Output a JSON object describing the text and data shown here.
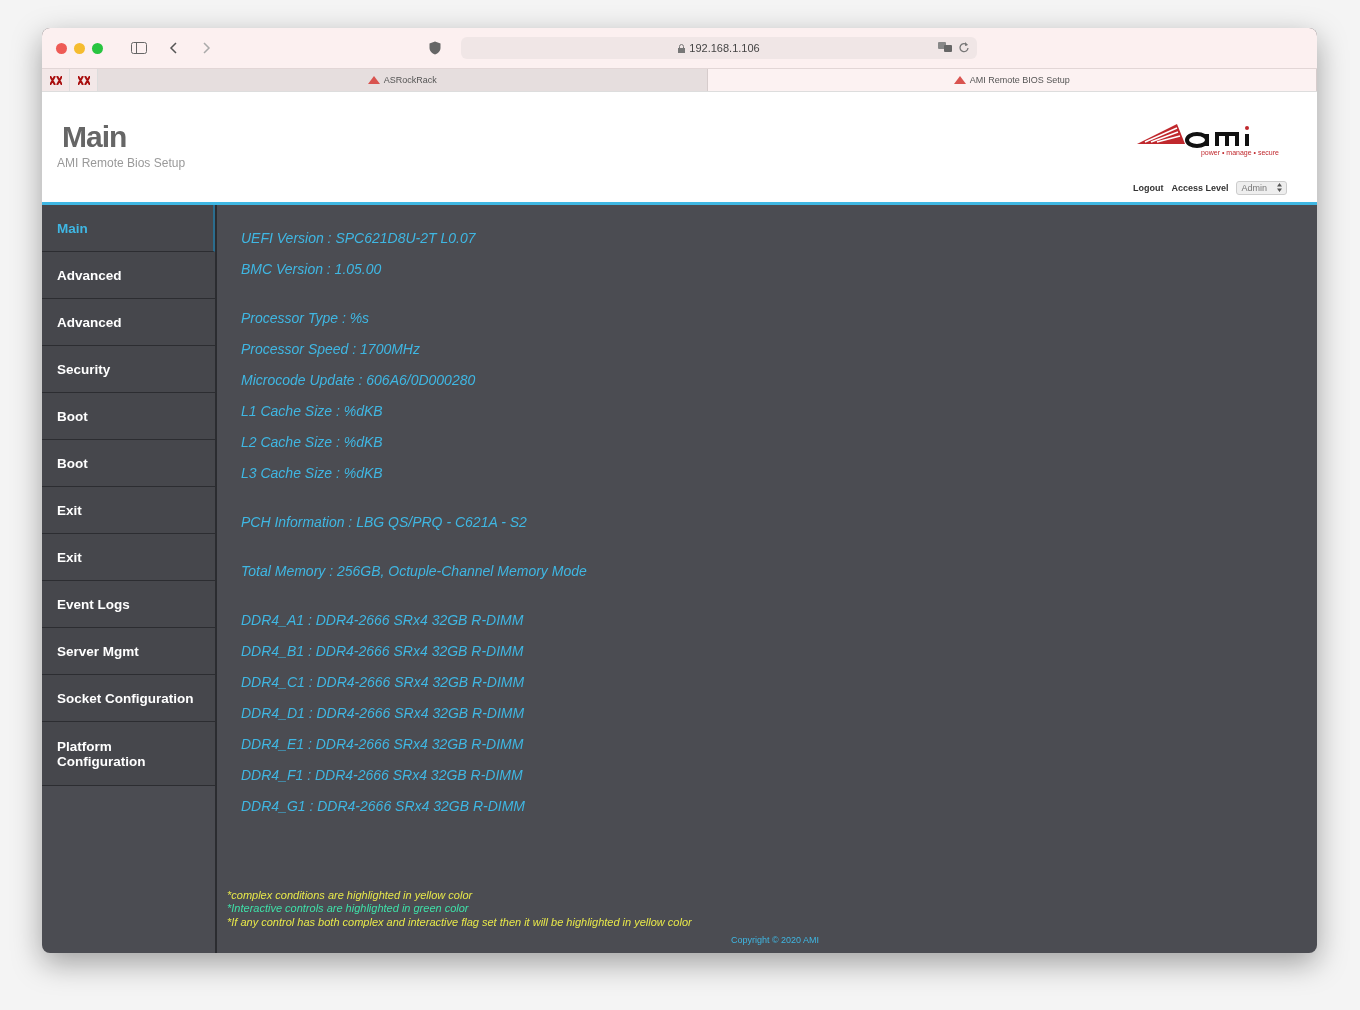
{
  "browser": {
    "address": "192.168.1.106",
    "tabs": [
      {
        "label": "ASRockRack",
        "selected": false
      },
      {
        "label": "AMI Remote BIOS Setup",
        "selected": true
      }
    ]
  },
  "header": {
    "logo_tagline": "power • manage • secure",
    "title": "Main",
    "subtitle": "AMI Remote Bios Setup",
    "logout": "Logout",
    "access_level_label": "Access Level",
    "access_level": "Admin"
  },
  "sidebar": {
    "items": [
      {
        "label": "Main",
        "selected": true
      },
      {
        "label": "Advanced",
        "selected": false
      },
      {
        "label": "Advanced",
        "selected": false
      },
      {
        "label": "Security",
        "selected": false
      },
      {
        "label": "Boot",
        "selected": false
      },
      {
        "label": "Boot",
        "selected": false
      },
      {
        "label": "Exit",
        "selected": false
      },
      {
        "label": "Exit",
        "selected": false
      },
      {
        "label": "Event Logs",
        "selected": false
      },
      {
        "label": "Server Mgmt",
        "selected": false
      },
      {
        "label": "Socket Configuration",
        "selected": false
      },
      {
        "label": "Platform Configuration",
        "selected": false
      }
    ]
  },
  "info_groups": [
    [
      "UEFI Version : SPC621D8U-2T L0.07",
      "BMC Version : 1.05.00"
    ],
    [
      "Processor Type : %s",
      "Processor Speed : 1700MHz",
      "Microcode Update : 606A6/0D000280",
      "L1 Cache Size : %dKB",
      "L2 Cache Size : %dKB",
      "L3 Cache Size : %dKB"
    ],
    [
      "PCH Information : LBG QS/PRQ - C621A - S2"
    ],
    [
      "Total Memory : 256GB, Octuple-Channel Memory Mode"
    ],
    [
      "DDR4_A1 : DDR4-2666 SRx4 32GB R-DIMM",
      "DDR4_B1 : DDR4-2666 SRx4 32GB R-DIMM",
      "DDR4_C1 : DDR4-2666 SRx4 32GB R-DIMM",
      "DDR4_D1 : DDR4-2666 SRx4 32GB R-DIMM",
      "DDR4_E1 : DDR4-2666 SRx4 32GB R-DIMM",
      "DDR4_F1 : DDR4-2666 SRx4 32GB R-DIMM",
      "DDR4_G1 : DDR4-2666 SRx4 32GB R-DIMM"
    ]
  ],
  "notes": [
    {
      "text": "*complex conditions are highlighted in yellow color",
      "color": "#e8e84a"
    },
    {
      "text": "*Interactive controls are highlighted in green color",
      "color": "#3ee0a8"
    },
    {
      "text": "*If any control has both complex and interactive flag set then it will be highlighted in yellow color",
      "color": "#e8e84a"
    }
  ],
  "copyright": "Copyright © 2020 AMI"
}
